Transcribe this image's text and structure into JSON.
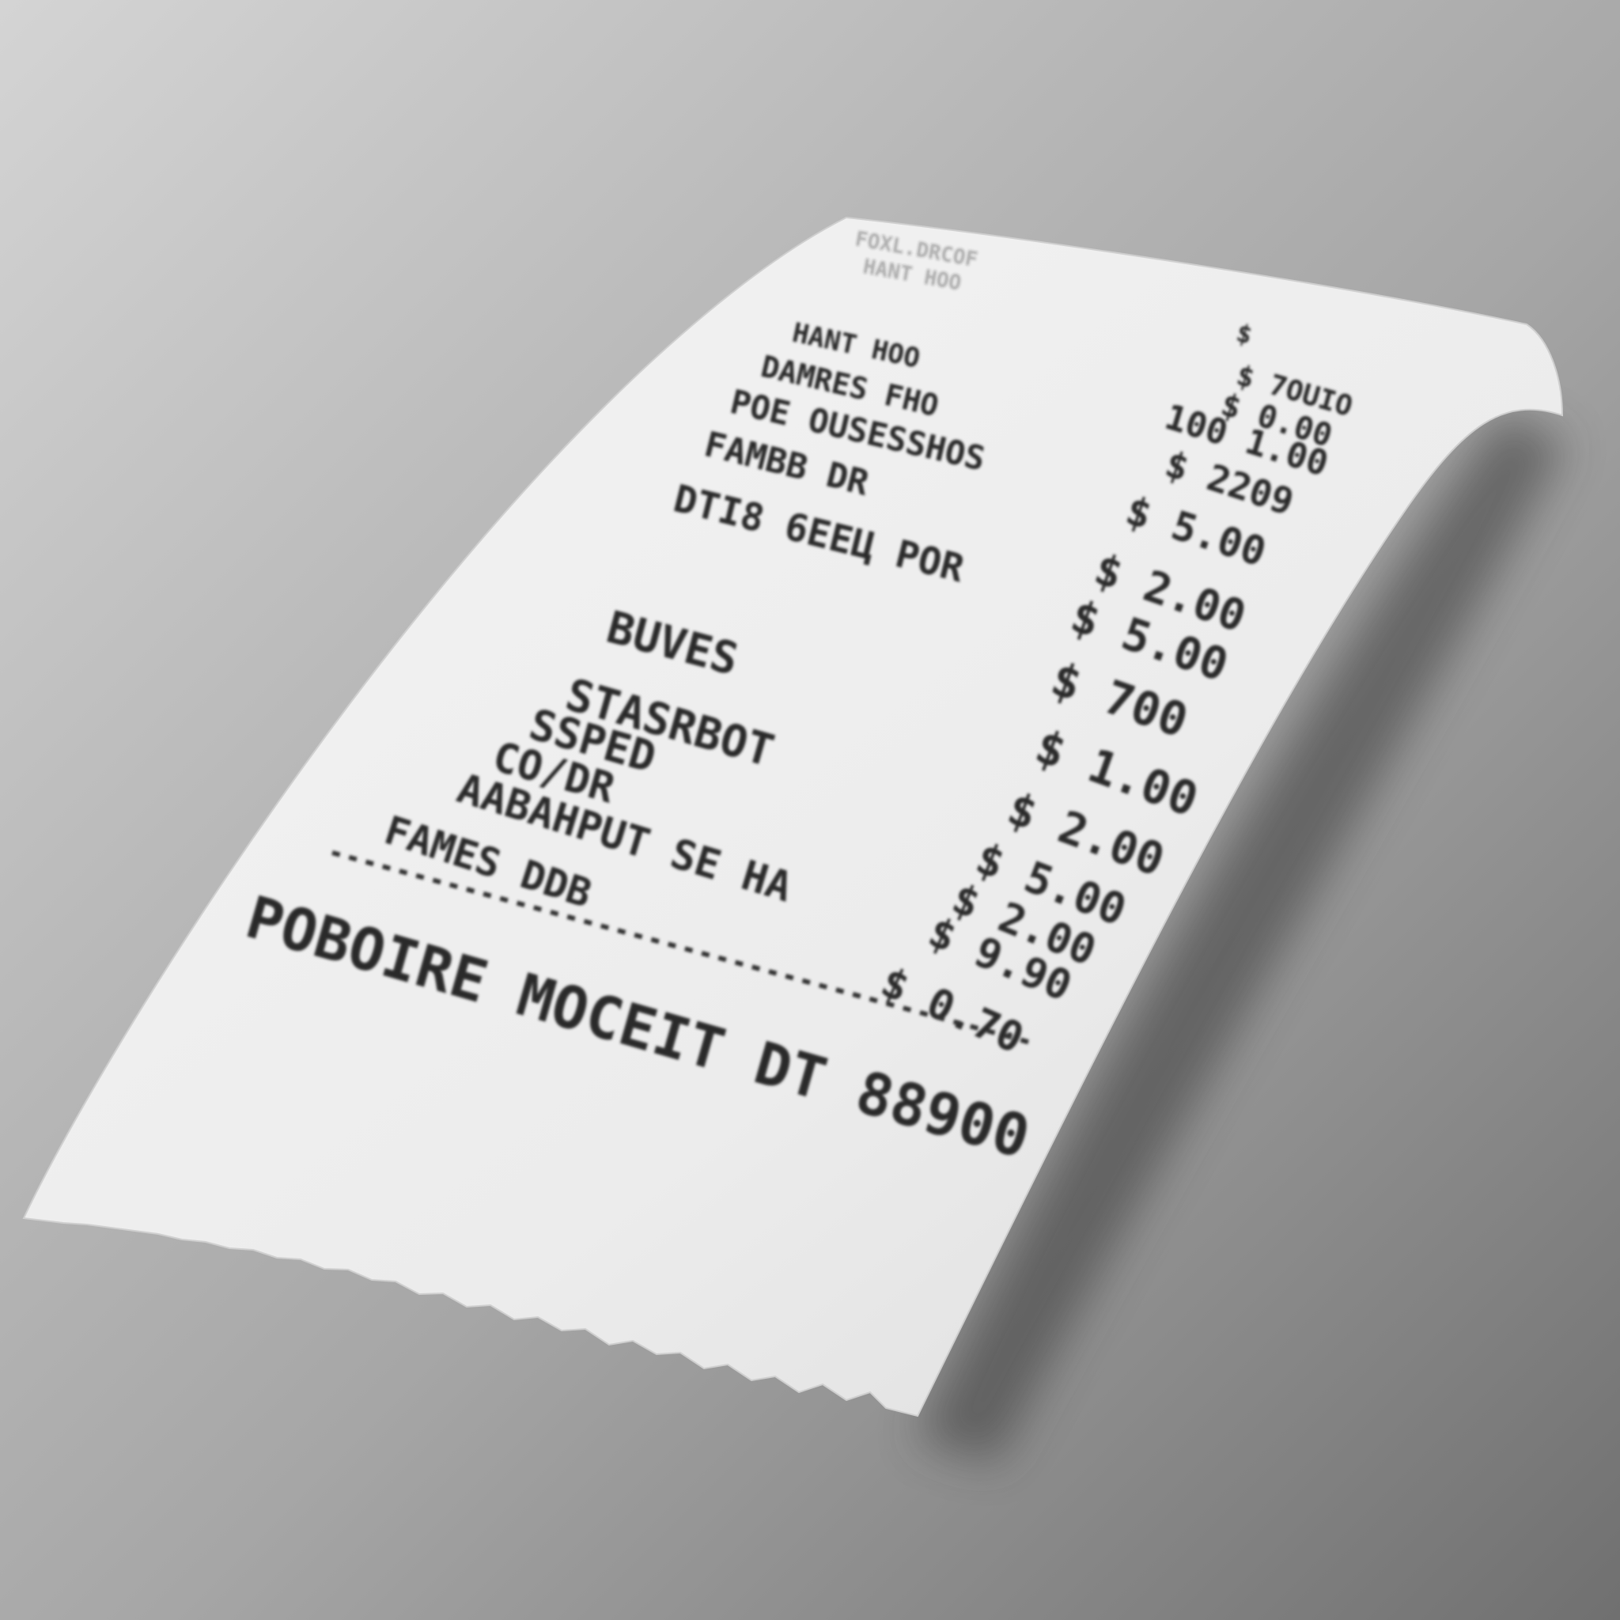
{
  "colors": {
    "background_light": "#d2d2d2",
    "background_dark": "#6e6e6e",
    "paper": "#f2f2f2",
    "ink": "#2a2a2a"
  },
  "receipt": {
    "header_lines": [
      "FOXL.DRCOF",
      "HANT HOO"
    ],
    "items": [
      {
        "label": "",
        "amount": "$"
      },
      {
        "label": "HANT HOO",
        "amount": "$ 7OUIO"
      },
      {
        "label": "DAMRES FHO",
        "amount": "$ 0.00"
      },
      {
        "label": "POE OUSESSHOS",
        "amount": "100 1.00"
      },
      {
        "label": "FAMBB DR",
        "amount": "$ 2209"
      },
      {
        "label": "DTI8 6EEЦ   POR",
        "amount": "$ 5.00"
      },
      {
        "label": "",
        "amount": "$ 2.00"
      },
      {
        "label": "",
        "amount": "$ 5.00"
      },
      {
        "label": "BUVES",
        "amount": "$ 700"
      },
      {
        "label": "STASRBOT",
        "amount": "$ 1.00"
      },
      {
        "label": "SSPED",
        "amount": "$ 2.00"
      },
      {
        "label": "CO/DR",
        "amount": ""
      },
      {
        "label": "AABAHPUT SE HA",
        "amount": "$ 5.00"
      },
      {
        "label": "FAMES DDB",
        "amount": "$ 2.00"
      },
      {
        "label": "",
        "amount": "$ 9.90"
      },
      {
        "label": "",
        "amount": "$ 0.70"
      }
    ],
    "footer": "POBOIRE MOCEIT DT 88900"
  }
}
